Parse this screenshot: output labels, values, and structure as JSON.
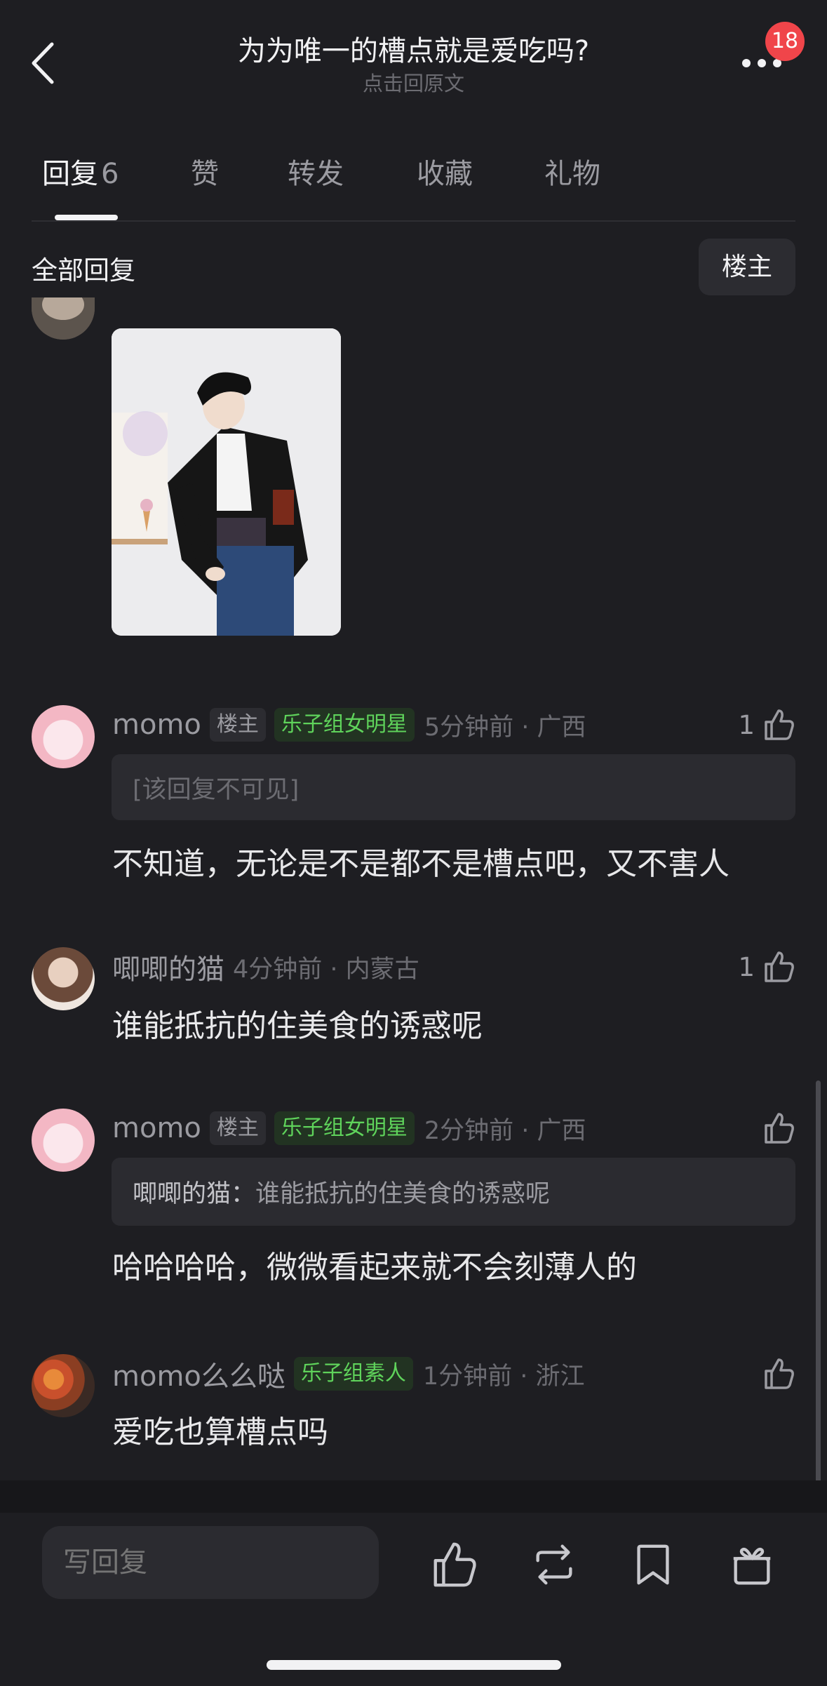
{
  "header": {
    "title": "为为唯一的槽点就是爱吃吗?",
    "subtitle": "点击回原文",
    "badge_count": "18"
  },
  "tabs": [
    {
      "label": "回复",
      "count": "6",
      "active": true
    },
    {
      "label": "赞",
      "count": "",
      "active": false
    },
    {
      "label": "转发",
      "count": "",
      "active": false
    },
    {
      "label": "收藏",
      "count": "",
      "active": false
    },
    {
      "label": "礼物",
      "count": "",
      "active": false
    }
  ],
  "filter": {
    "all_replies": "全部回复",
    "op_only": "楼主"
  },
  "comments": [
    {
      "username": "momo",
      "op_tag": "楼主",
      "group_tag": "乐子组女明星",
      "time": "5分钟前 · 广西",
      "likes": "1",
      "quote_user": "",
      "quote_text": "[该回复不可见]",
      "text": "不知道，无论是不是都不是槽点吧，又不害人"
    },
    {
      "username": "唧唧的猫",
      "op_tag": "",
      "group_tag": "",
      "time": "4分钟前 · 内蒙古",
      "likes": "1",
      "text": "谁能抵抗的住美食的诱惑呢"
    },
    {
      "username": "momo",
      "op_tag": "楼主",
      "group_tag": "乐子组女明星",
      "time": "2分钟前 · 广西",
      "likes": "",
      "quote_user": "唧唧的猫：",
      "quote_text": "谁能抵抗的住美食的诱惑呢",
      "text": "哈哈哈哈，微微看起来就不会刻薄人的"
    },
    {
      "username": "momo么么哒",
      "op_tag": "",
      "group_tag": "乐子组素人",
      "time": "1分钟前 · 浙江",
      "likes": "",
      "text": "爱吃也算槽点吗"
    }
  ],
  "bottom_bar": {
    "reply_placeholder": "写回复"
  },
  "icons": {
    "back": "chevron-left-icon",
    "more": "more-dots-icon",
    "like": "thumbs-up-icon",
    "repost": "repost-icon",
    "favorite": "bookmark-icon",
    "gift": "gift-icon"
  },
  "colors": {
    "background": "#1e1e22",
    "group_tag": "#5fd35b",
    "badge": "#f0454a"
  }
}
